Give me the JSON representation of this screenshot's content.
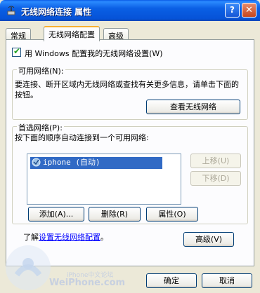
{
  "window": {
    "title": "无线网络连接 属性",
    "help_button": "?",
    "close_button": "✕"
  },
  "tabs": [
    {
      "label": "常规"
    },
    {
      "label": "无线网络配置"
    },
    {
      "label": "高级"
    }
  ],
  "use_windows": {
    "label": "用 Windows 配置我的无线网络设置(W)",
    "checked": true
  },
  "available": {
    "group_label": "可用网络(N):",
    "description": "要连接、断开区域内无线网络或查找有关更多信息，请单击下面的按钮。",
    "view_button": "查看无线网络"
  },
  "preferred": {
    "group_label": "首选网络(P):",
    "description": "按下面的顺序自动连接到一个可用网络:",
    "networks": [
      "iphone (自动)"
    ],
    "move_up": "上移(U)",
    "move_down": "下移(D)",
    "add": "添加(A)...",
    "remove": "删除(R)",
    "properties": "属性(O)"
  },
  "learn": {
    "prefix": "了解",
    "link": "设置无线网络配置",
    "suffix": "。"
  },
  "advanced_button": "高级(V)",
  "ok_button": "确定",
  "cancel_button": "取消",
  "watermark": {
    "small": "iPhone中文论坛",
    "big": "WeiPhone.com"
  }
}
